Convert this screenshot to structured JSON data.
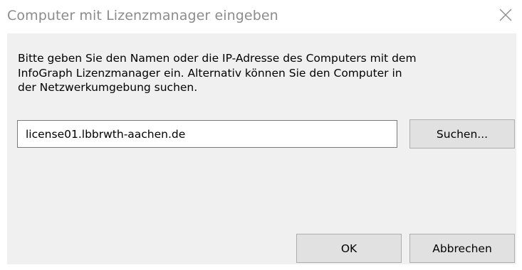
{
  "dialog": {
    "title": "Computer mit Lizenzmanager eingeben",
    "close_icon": "close-icon",
    "message": "Bitte geben Sie den Namen oder die IP-Adresse des Computers mit dem\nInfoGraph Lizenzmanager ein. Alternativ können Sie den Computer in\nder Netzwerkumgebung suchen.",
    "host_input": {
      "value": "license01.lbbrwth-aachen.de",
      "placeholder": ""
    },
    "search_button": "Suchen...",
    "ok_button": "OK",
    "cancel_button": "Abbrechen"
  },
  "colors": {
    "title_text": "#8c8c8c",
    "content_background": "#f0f0f0",
    "button_background": "#e1e1e1",
    "button_border": "#adadad",
    "input_border": "#7a7a7a"
  }
}
